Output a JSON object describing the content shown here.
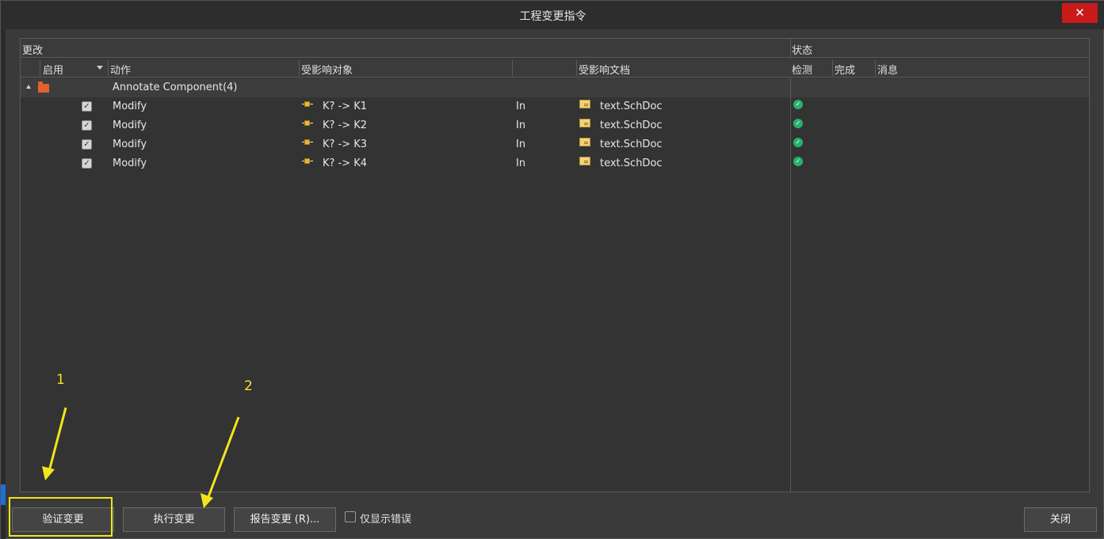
{
  "window": {
    "title": "工程变更指令",
    "close_glyph": "✕"
  },
  "table": {
    "group_headers": {
      "changes": "更改",
      "status": "状态"
    },
    "columns": {
      "enable": "启用",
      "action": "动作",
      "affected_object": "受影响对象",
      "affected_document": "受影响文档",
      "check": "检测",
      "done": "完成",
      "message": "消息"
    },
    "group": {
      "label": "Annotate Component(4)"
    },
    "rows": [
      {
        "enabled": true,
        "action": "Modify",
        "object": "K? -> K1",
        "direction": "In",
        "document": "text.SchDoc",
        "check_ok": true
      },
      {
        "enabled": true,
        "action": "Modify",
        "object": "K? -> K2",
        "direction": "In",
        "document": "text.SchDoc",
        "check_ok": true
      },
      {
        "enabled": true,
        "action": "Modify",
        "object": "K? -> K3",
        "direction": "In",
        "document": "text.SchDoc",
        "check_ok": true
      },
      {
        "enabled": true,
        "action": "Modify",
        "object": "K? -> K4",
        "direction": "In",
        "document": "text.SchDoc",
        "check_ok": true
      }
    ]
  },
  "footer": {
    "validate_label": "验证变更",
    "execute_label": "执行变更",
    "report_label": "报告变更 (R)...",
    "only_errors_label": "仅显示错误",
    "close_label": "关闭"
  },
  "annotations": {
    "one": "1",
    "two": "2",
    "color": "#f2e51b"
  },
  "icons": {
    "check_mark": "✓",
    "folder": "folder-icon",
    "component": "component-icon",
    "document": "schdoc-icon",
    "status_ok": "ok-icon"
  }
}
